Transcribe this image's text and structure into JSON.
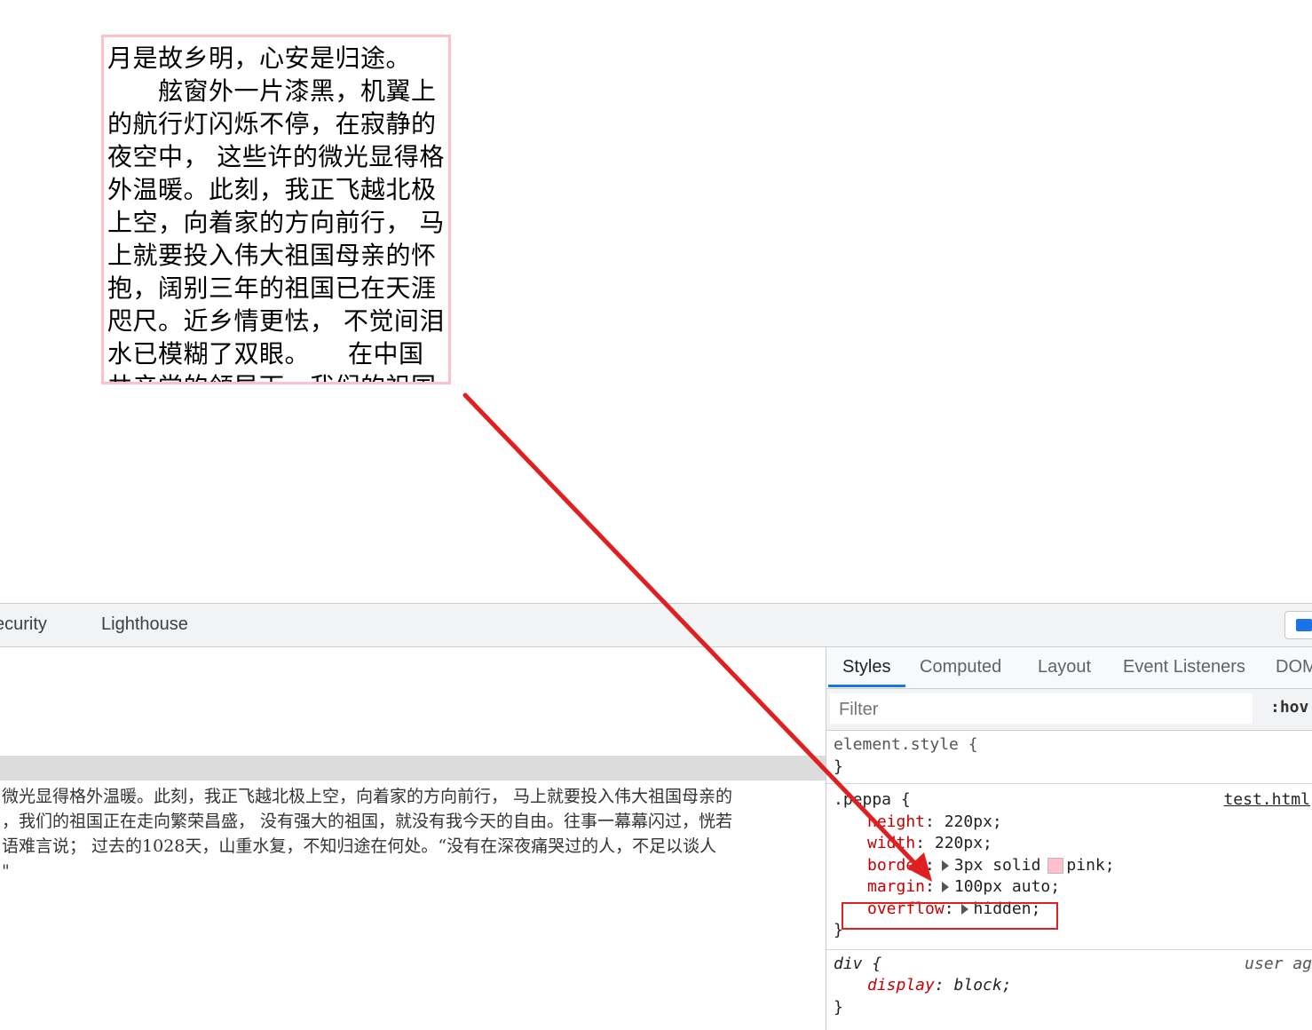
{
  "page": {
    "peppa_text": "月是故乡明，心安是归途。\n　　舷窗外一片漆黑，机翼上的航行灯闪烁不停，在寂静的夜空中， 这些许的微光显得格外温暖。此刻，我正飞越北极上空，向着家的方向前行， 马上就要投入伟大祖国母亲的怀抱，阔别三年的祖国已在天涯咫尺。近乡情更怯， 不觉间泪水已模糊了双眼。　　在中国共产党的领导下，我们的祖国"
  },
  "devtools": {
    "tabs": [
      "ecurity",
      "Lighthouse"
    ],
    "elements_text_lines": [
      "微光显得格外温暖。此刻，我正飞越北极上空，向着家的方向前行， 马上就要投入伟大祖国母亲的",
      "，我们的祖国正在走向繁荣昌盛， 没有强大的祖国，就没有我今天的自由。往事一幕幕闪过，恍若",
      "语难言说； 过去的1028天，山重水复，不知归途在何处。“没有在深夜痛哭过的人，不足以谈人",
      " \""
    ],
    "styles": {
      "subtabs": [
        "Styles",
        "Computed",
        "Layout",
        "Event Listeners",
        "DOM"
      ],
      "filter_placeholder": "Filter",
      "hov_label": ":hov",
      "element_style": {
        "selector": "element.style {",
        "close": "}"
      },
      "peppa_rule": {
        "selector": ".peppa {",
        "source": "test.html",
        "props": [
          {
            "name": "height",
            "value": "220px;"
          },
          {
            "name": "width",
            "value": "220px;"
          },
          {
            "name": "border",
            "value": "3px solid",
            "color_name": "pink;",
            "color": "#ffc0cb"
          },
          {
            "name": "margin",
            "value": "100px auto;"
          },
          {
            "name": "overflow",
            "value": "hidden;"
          }
        ],
        "close": "}"
      },
      "div_rule": {
        "selector": "div {",
        "source": "user ag",
        "prop_name": "display",
        "prop_value": "block;",
        "close": "}"
      }
    }
  },
  "annotation_color": "#e02020"
}
